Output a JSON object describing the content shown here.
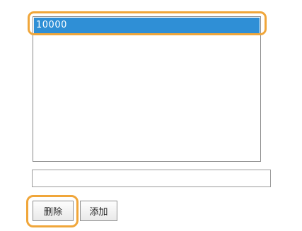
{
  "listbox": {
    "items": [
      {
        "label": "10000",
        "selected": true
      }
    ]
  },
  "input": {
    "value": "",
    "placeholder": ""
  },
  "buttons": {
    "delete_label": "删除",
    "add_label": "添加"
  },
  "colors": {
    "selection": "#2f8fd6",
    "highlight": "#f0a63a"
  }
}
